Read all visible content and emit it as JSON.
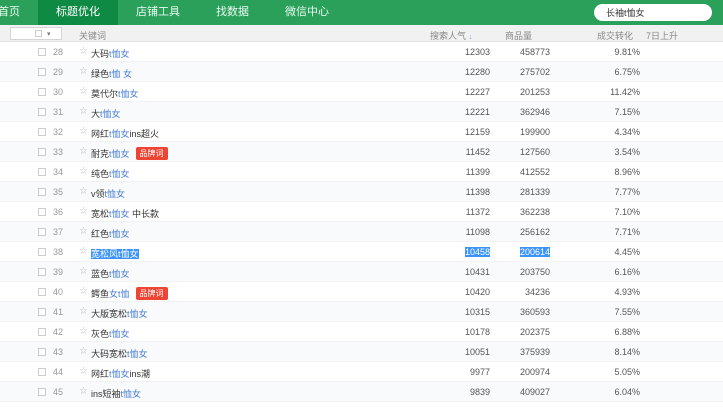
{
  "nav": {
    "items": [
      {
        "label": "首页",
        "active": false
      },
      {
        "label": "标题优化",
        "active": true
      },
      {
        "label": "店铺工具",
        "active": false
      },
      {
        "label": "找数据",
        "active": false
      },
      {
        "label": "微信中心",
        "active": false
      }
    ],
    "search_value": "长袖t恤女"
  },
  "colors": {
    "nav_green": "#2aa05a",
    "nav_active_green": "#0f8a44",
    "keyword_link_blue": "#4a7fd6",
    "selection_blue": "#3c93fd",
    "badge_red": "#ee4433"
  },
  "table": {
    "filter": {
      "dropdown_caret": "▾",
      "keyword_label": "关键词"
    },
    "headers": {
      "popularity": "搜索人气",
      "sort_icon": "↓",
      "products": "商品量",
      "conversion": "成交转化",
      "rise7": "7日上升"
    },
    "badge_label": "品牌词",
    "star_glyph": "☆",
    "rows": [
      {
        "rank": "28",
        "parts": [
          {
            "t": "大码",
            "h": false
          },
          {
            "t": "t恤女",
            "h": true
          }
        ],
        "badge": false,
        "selected": false,
        "popularity": "12303",
        "products": "458773",
        "conversion": "9.81%"
      },
      {
        "rank": "29",
        "parts": [
          {
            "t": "绿色",
            "h": false
          },
          {
            "t": "t恤 女",
            "h": true
          }
        ],
        "badge": false,
        "selected": false,
        "popularity": "12280",
        "products": "275702",
        "conversion": "6.75%"
      },
      {
        "rank": "30",
        "parts": [
          {
            "t": "莫代尔",
            "h": false
          },
          {
            "t": "t恤女",
            "h": true
          }
        ],
        "badge": false,
        "selected": false,
        "popularity": "12227",
        "products": "201253",
        "conversion": "11.42%"
      },
      {
        "rank": "31",
        "parts": [
          {
            "t": "大",
            "h": false
          },
          {
            "t": "t恤女",
            "h": true
          }
        ],
        "badge": false,
        "selected": false,
        "popularity": "12221",
        "products": "362946",
        "conversion": "7.15%"
      },
      {
        "rank": "32",
        "parts": [
          {
            "t": "网红",
            "h": false
          },
          {
            "t": "t恤女",
            "h": true
          },
          {
            "t": "ins超火",
            "h": false
          }
        ],
        "badge": false,
        "selected": false,
        "popularity": "12159",
        "products": "199900",
        "conversion": "4.34%"
      },
      {
        "rank": "33",
        "parts": [
          {
            "t": "耐克",
            "h": false
          },
          {
            "t": "t恤女",
            "h": true
          }
        ],
        "badge": true,
        "selected": false,
        "popularity": "11452",
        "products": "127560",
        "conversion": "3.54%"
      },
      {
        "rank": "34",
        "parts": [
          {
            "t": "纯色",
            "h": false
          },
          {
            "t": "t恤女",
            "h": true
          }
        ],
        "badge": false,
        "selected": false,
        "popularity": "11399",
        "products": "412552",
        "conversion": "8.96%"
      },
      {
        "rank": "35",
        "parts": [
          {
            "t": "v领",
            "h": false
          },
          {
            "t": "t恤女",
            "h": true
          }
        ],
        "badge": false,
        "selected": false,
        "popularity": "11398",
        "products": "281339",
        "conversion": "7.77%"
      },
      {
        "rank": "36",
        "parts": [
          {
            "t": "宽松",
            "h": false
          },
          {
            "t": "t恤女",
            "h": true
          },
          {
            "t": " 中长款",
            "h": false
          }
        ],
        "badge": false,
        "selected": false,
        "popularity": "11372",
        "products": "362238",
        "conversion": "7.10%"
      },
      {
        "rank": "37",
        "parts": [
          {
            "t": "红色",
            "h": false
          },
          {
            "t": "t恤女",
            "h": true
          }
        ],
        "badge": false,
        "selected": false,
        "popularity": "11098",
        "products": "256162",
        "conversion": "7.71%"
      },
      {
        "rank": "38",
        "parts": [
          {
            "t": "宽松风t恤女",
            "h": true
          }
        ],
        "badge": false,
        "selected": true,
        "popularity": "10458",
        "products": "200614",
        "conversion": "4.45%"
      },
      {
        "rank": "39",
        "parts": [
          {
            "t": "蓝色",
            "h": false
          },
          {
            "t": "t恤女",
            "h": true
          }
        ],
        "badge": false,
        "selected": false,
        "popularity": "10431",
        "products": "203750",
        "conversion": "6.16%"
      },
      {
        "rank": "40",
        "parts": [
          {
            "t": "鳄鱼",
            "h": false
          },
          {
            "t": "女t恤",
            "h": true
          }
        ],
        "badge": true,
        "selected": false,
        "popularity": "10420",
        "products": "34236",
        "conversion": "4.93%"
      },
      {
        "rank": "41",
        "parts": [
          {
            "t": "大版宽松",
            "h": false
          },
          {
            "t": "t恤女",
            "h": true
          }
        ],
        "badge": false,
        "selected": false,
        "popularity": "10315",
        "products": "360593",
        "conversion": "7.55%"
      },
      {
        "rank": "42",
        "parts": [
          {
            "t": "灰色",
            "h": false
          },
          {
            "t": "t恤女",
            "h": true
          }
        ],
        "badge": false,
        "selected": false,
        "popularity": "10178",
        "products": "202375",
        "conversion": "6.88%"
      },
      {
        "rank": "43",
        "parts": [
          {
            "t": "大码宽松",
            "h": false
          },
          {
            "t": "t恤女",
            "h": true
          }
        ],
        "badge": false,
        "selected": false,
        "popularity": "10051",
        "products": "375939",
        "conversion": "8.14%"
      },
      {
        "rank": "44",
        "parts": [
          {
            "t": "网红",
            "h": false
          },
          {
            "t": "t恤女",
            "h": true
          },
          {
            "t": "ins潮",
            "h": false
          }
        ],
        "badge": false,
        "selected": false,
        "popularity": "9977",
        "products": "200974",
        "conversion": "5.05%"
      },
      {
        "rank": "45",
        "parts": [
          {
            "t": "ins短袖",
            "h": false
          },
          {
            "t": "t恤女",
            "h": true
          }
        ],
        "badge": false,
        "selected": false,
        "popularity": "9839",
        "products": "409027",
        "conversion": "6.04%"
      }
    ]
  }
}
